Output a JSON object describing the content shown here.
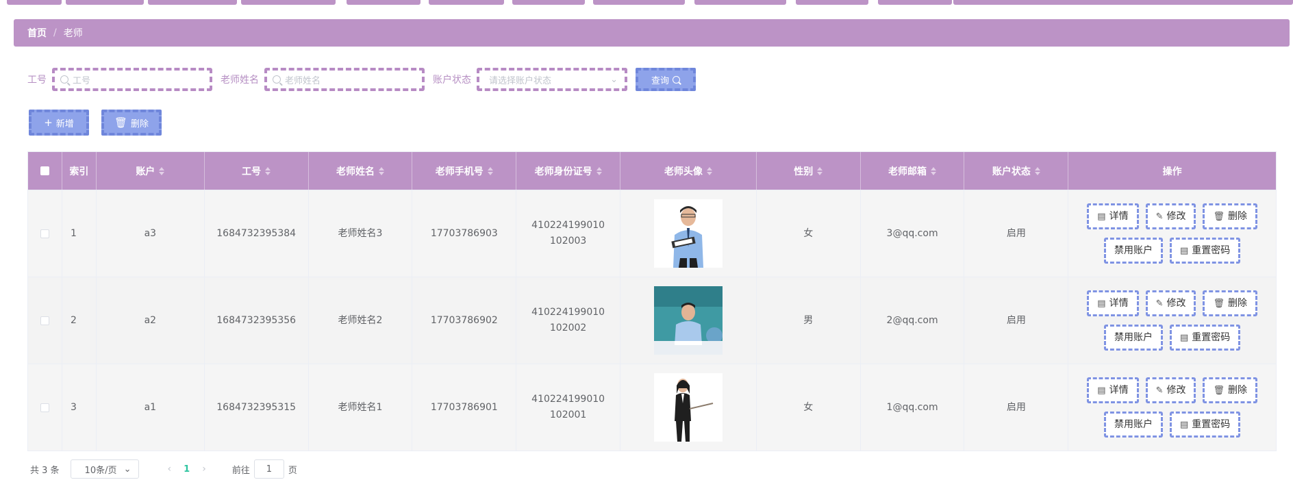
{
  "breadcrumb": {
    "home": "首页",
    "separator": "/",
    "current": "老师"
  },
  "search": {
    "job_no_label": "工号",
    "job_no_placeholder": "工号",
    "name_label": "老师姓名",
    "name_placeholder": "老师姓名",
    "status_label": "账户状态",
    "status_placeholder": "请选择账户状态",
    "query_label": "查询"
  },
  "actions": {
    "add_label": "新增",
    "delete_label": "删除"
  },
  "table": {
    "columns": [
      "索引",
      "账户",
      "工号",
      "老师姓名",
      "老师手机号",
      "老师身份证号",
      "老师头像",
      "性别",
      "老师邮箱",
      "账户状态",
      "操作"
    ],
    "rows": [
      {
        "index": "1",
        "account": "a3",
        "job_no": "1684732395384",
        "name": "老师姓名3",
        "phone": "17703786903",
        "id_card": "410224199010102003",
        "gender": "女",
        "email": "3@qq.com",
        "status": "启用"
      },
      {
        "index": "2",
        "account": "a2",
        "job_no": "1684732395356",
        "name": "老师姓名2",
        "phone": "17703786902",
        "id_card": "410224199010102002",
        "gender": "男",
        "email": "2@qq.com",
        "status": "启用"
      },
      {
        "index": "3",
        "account": "a1",
        "job_no": "1684732395315",
        "name": "老师姓名1",
        "phone": "17703786901",
        "id_card": "410224199010102001",
        "gender": "女",
        "email": "1@qq.com",
        "status": "启用"
      }
    ],
    "row_actions": {
      "detail": "详情",
      "edit": "修改",
      "delete": "删除",
      "disable": "禁用账户",
      "reset": "重置密码"
    }
  },
  "pagination": {
    "total": "共 3 条",
    "page_size": "10条/页",
    "current_page": "1",
    "goto_prefix": "前往",
    "goto_value": "1",
    "goto_suffix": "页"
  },
  "colors": {
    "theme": "#bc93c6",
    "button": "#8ea3ea",
    "button_border": "#6f86db",
    "page_active": "#2ec4a0"
  }
}
